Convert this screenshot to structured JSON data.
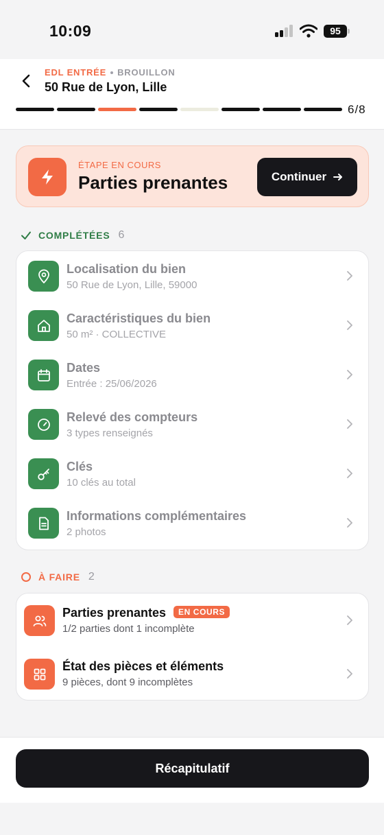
{
  "status_bar": {
    "time": "10:09",
    "battery": "95"
  },
  "header": {
    "type_label": "EDL ENTRÉE",
    "status_label": "BROUILLON",
    "address": "50 Rue de Lyon, Lille",
    "progress": {
      "current_step": 6,
      "total_steps": 8,
      "label": "6/8"
    }
  },
  "current_step": {
    "label": "ÉTAPE EN COURS",
    "title": "Parties prenantes",
    "button_label": "Continuer"
  },
  "completed": {
    "label": "COMPLÉTÉES",
    "count": "6",
    "items": [
      {
        "title": "Localisation du bien",
        "subtitle": "50 Rue de Lyon, Lille, 59000",
        "icon": "map-pin-icon"
      },
      {
        "title": "Caractéristiques du bien",
        "subtitle": "50 m² · COLLECTIVE",
        "icon": "home-icon"
      },
      {
        "title": "Dates",
        "subtitle": "Entrée : 25/06/2026",
        "icon": "calendar-icon"
      },
      {
        "title": "Relevé des compteurs",
        "subtitle": "3 types renseignés",
        "icon": "gauge-icon"
      },
      {
        "title": "Clés",
        "subtitle": "10 clés au total",
        "icon": "key-icon"
      },
      {
        "title": "Informations complémentaires",
        "subtitle": "2 photos",
        "icon": "document-icon"
      }
    ]
  },
  "todo": {
    "label": "À FAIRE",
    "count": "2",
    "items": [
      {
        "title": "Parties prenantes",
        "badge": "EN COURS",
        "subtitle": "1/2 parties dont 1 incomplète",
        "icon": "users-icon"
      },
      {
        "title": "État des pièces et éléments",
        "subtitle": "9 pièces, dont 9 incomplètes",
        "icon": "grid-icon"
      }
    ]
  },
  "footer": {
    "button_label": "Récapitulatif"
  },
  "colors": {
    "accent": "#f26a45",
    "success": "#3a8f52",
    "dark": "#17171b"
  }
}
